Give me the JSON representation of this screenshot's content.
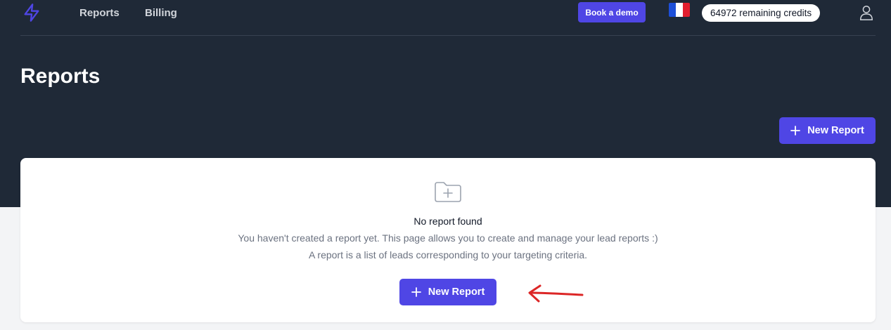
{
  "nav": {
    "links": [
      "Reports",
      "Billing"
    ],
    "book_demo_label": "Book a demo",
    "credits_label": "64972 remaining credits"
  },
  "page": {
    "title": "Reports",
    "new_report_label": "New Report"
  },
  "empty_state": {
    "title": "No report found",
    "description_line1": "You haven't created a report yet. This page allows you to create and manage your lead reports :)",
    "description_line2": "A report is a list of leads corresponding to your targeting criteria.",
    "button_label": "New Report"
  },
  "icons": {
    "logo": "lightning-bolt-icon",
    "flag": "france-flag-icon",
    "user": "user-icon",
    "folder": "folder-plus-icon",
    "plus": "plus-icon",
    "annotation": "hand-drawn-arrow-icon"
  },
  "colors": {
    "accent": "#4f46e5",
    "header_bg": "#1f2937",
    "page_bg": "#f3f4f6",
    "annotation": "#dc2626",
    "flag_blue": "#1d4fd8",
    "flag_white": "#ffffff",
    "flag_red": "#e11d2e"
  }
}
